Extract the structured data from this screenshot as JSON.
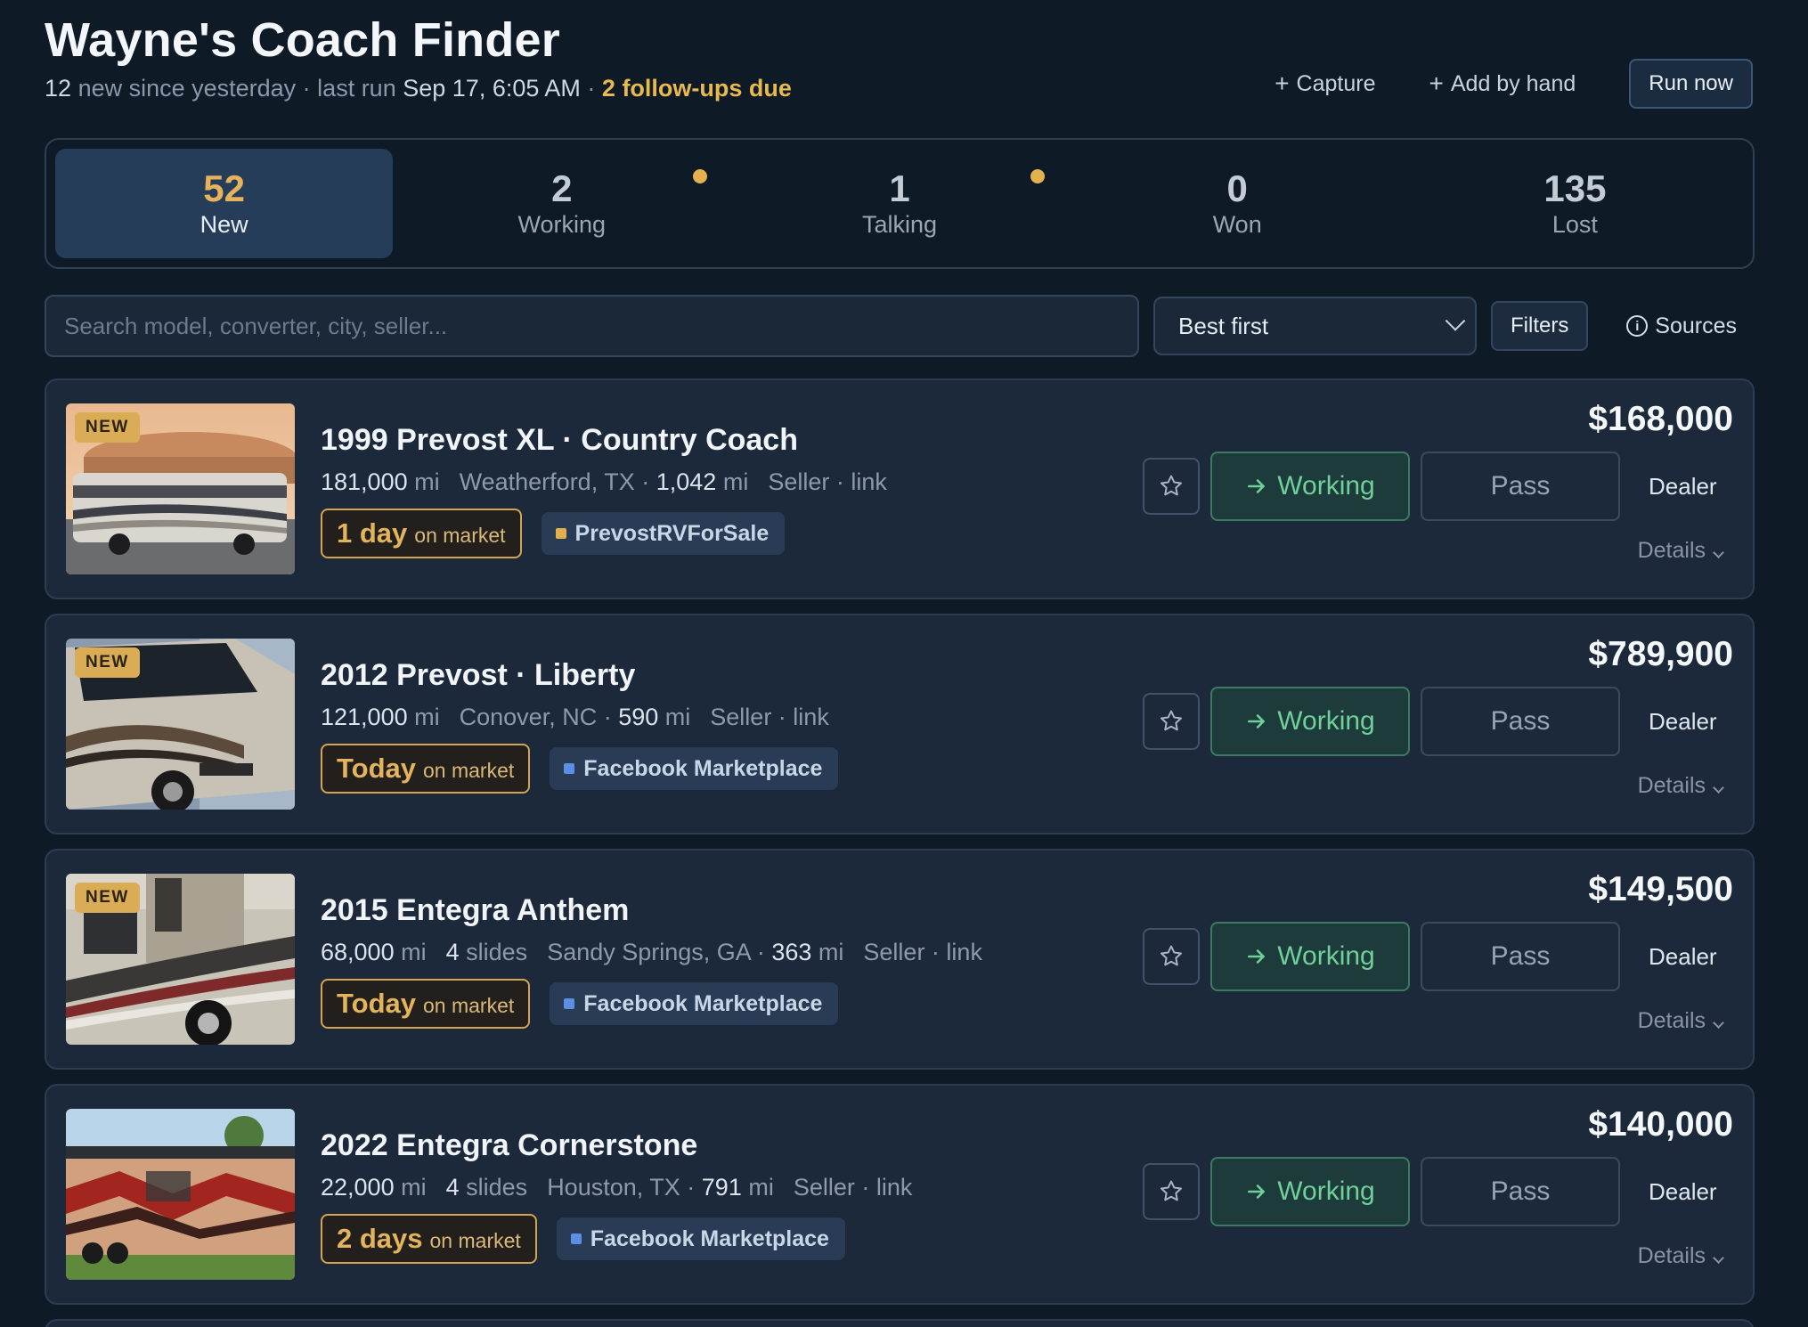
{
  "header": {
    "title": "Wayne's Coach Finder",
    "new_count": "12",
    "new_text": "new since yesterday · last run",
    "last_run": "Sep 17, 6:05 AM",
    "separator": "·",
    "followups": "2 follow-ups due",
    "capture_label": "Capture",
    "add_label": "Add by hand",
    "run_label": "Run now"
  },
  "stages": [
    {
      "count": "52",
      "label": "New",
      "dot": false,
      "active": true
    },
    {
      "count": "2",
      "label": "Working",
      "dot": true,
      "active": false
    },
    {
      "count": "1",
      "label": "Talking",
      "dot": true,
      "active": false
    },
    {
      "count": "0",
      "label": "Won",
      "dot": false,
      "active": false
    },
    {
      "count": "135",
      "label": "Lost",
      "dot": false,
      "active": false
    }
  ],
  "toolbar": {
    "search_placeholder": "Search model, converter, city, seller...",
    "sort_value": "Best first",
    "filters_label": "Filters",
    "sources_label": "Sources"
  },
  "colors": {
    "accent_gold": "#e3b45c",
    "working_green": "#6fd09b",
    "source_prevost": "#e0b050",
    "source_facebook": "#5b8fe6"
  },
  "listings": [
    {
      "is_new": true,
      "new_label": "NEW",
      "title": "1999 Prevost XL · Country Coach",
      "miles_num": "181,000",
      "miles_unit": "mi",
      "slides_num": "",
      "slides_unit": "",
      "city": "Weatherford, TX ·",
      "dist_num": "1,042",
      "dist_unit": "mi",
      "seller": "Seller · link",
      "age": "1 day",
      "age_suffix": "on market",
      "source": "PrevostRVForSale",
      "source_color": "#e0b050",
      "price": "$168,000",
      "working_label": "Working",
      "pass_label": "Pass",
      "dealer_label": "Dealer",
      "details_label": "Details",
      "thumb": "dome"
    },
    {
      "is_new": true,
      "new_label": "NEW",
      "title": "2012 Prevost · Liberty",
      "miles_num": "121,000",
      "miles_unit": "mi",
      "slides_num": "",
      "slides_unit": "",
      "city": "Conover, NC ·",
      "dist_num": "590",
      "dist_unit": "mi",
      "seller": "Seller · link",
      "age": "Today",
      "age_suffix": "on market",
      "source": "Facebook Marketplace",
      "source_color": "#5b8fe6",
      "price": "$789,900",
      "working_label": "Working",
      "pass_label": "Pass",
      "dealer_label": "Dealer",
      "details_label": "Details",
      "thumb": "front"
    },
    {
      "is_new": true,
      "new_label": "NEW",
      "title": "2015 Entegra Anthem",
      "miles_num": "68,000",
      "miles_unit": "mi",
      "slides_num": "4",
      "slides_unit": "slides",
      "city": "Sandy Springs, GA ·",
      "dist_num": "363",
      "dist_unit": "mi",
      "seller": "Seller · link",
      "age": "Today",
      "age_suffix": "on market",
      "source": "Facebook Marketplace",
      "source_color": "#5b8fe6",
      "price": "$149,500",
      "working_label": "Working",
      "pass_label": "Pass",
      "dealer_label": "Dealer",
      "details_label": "Details",
      "thumb": "side"
    },
    {
      "is_new": false,
      "new_label": "",
      "title": "2022 Entegra Cornerstone",
      "miles_num": "22,000",
      "miles_unit": "mi",
      "slides_num": "4",
      "slides_unit": "slides",
      "city": "Houston, TX ·",
      "dist_num": "791",
      "dist_unit": "mi",
      "seller": "Seller · link",
      "age": "2 days",
      "age_suffix": "on market",
      "source": "Facebook Marketplace",
      "source_color": "#5b8fe6",
      "price": "$140,000",
      "working_label": "Working",
      "pass_label": "Pass",
      "dealer_label": "Dealer",
      "details_label": "Details",
      "thumb": "red"
    }
  ]
}
